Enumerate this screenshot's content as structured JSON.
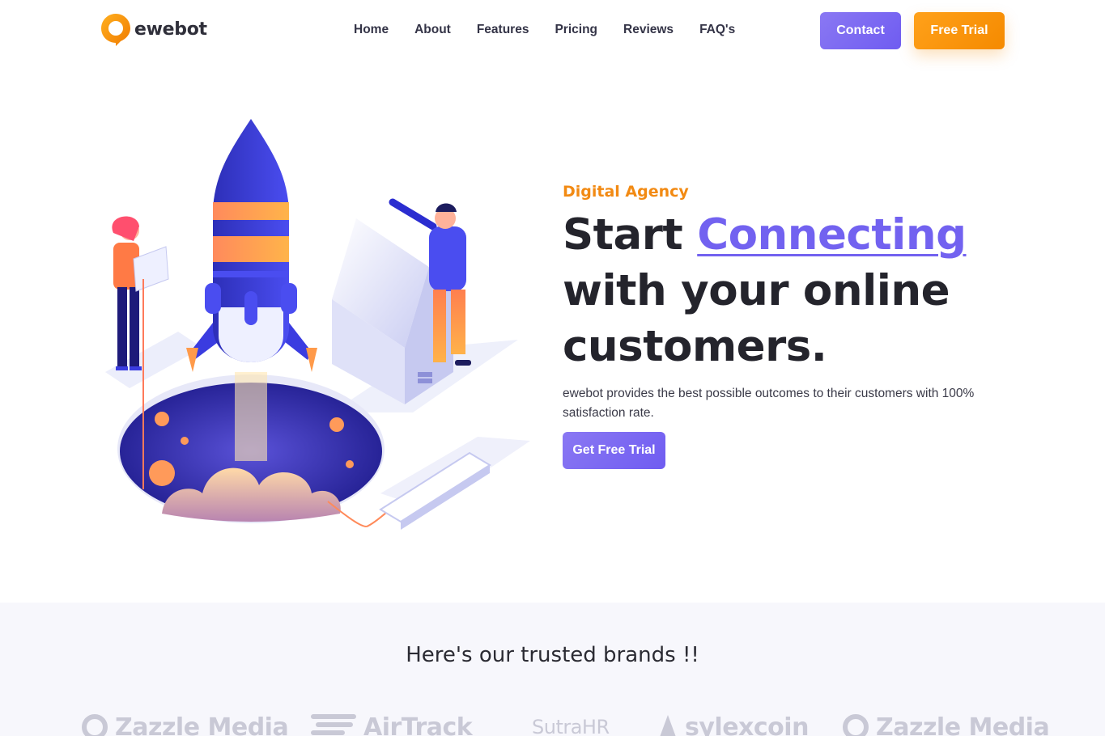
{
  "brand": {
    "name": "ewebot"
  },
  "nav": {
    "items": [
      {
        "label": "Home"
      },
      {
        "label": "About"
      },
      {
        "label": "Features"
      },
      {
        "label": "Pricing"
      },
      {
        "label": "Reviews"
      },
      {
        "label": "FAQ's"
      }
    ]
  },
  "header": {
    "contact_label": "Contact",
    "trial_label": "Free Trial"
  },
  "hero": {
    "eyebrow": "Digital Agency",
    "headline_pre": "Start ",
    "headline_highlight": "Connecting",
    "headline_post": "with your online customers.",
    "description": "ewebot provides the best possible outcomes to their customers with 100% satisfaction rate.",
    "cta_label": "Get Free Trial"
  },
  "brands": {
    "title": "Here's our trusted brands !!",
    "logos": [
      {
        "name": "Zazzle Media"
      },
      {
        "name": "AirTrack"
      },
      {
        "name": "SutraHR"
      },
      {
        "name": "sylexcoin"
      },
      {
        "name": "Zazzle Media"
      }
    ]
  },
  "colors": {
    "accent_purple": "#7262f0",
    "accent_orange": "#f58a00",
    "text_dark": "#24242c"
  }
}
